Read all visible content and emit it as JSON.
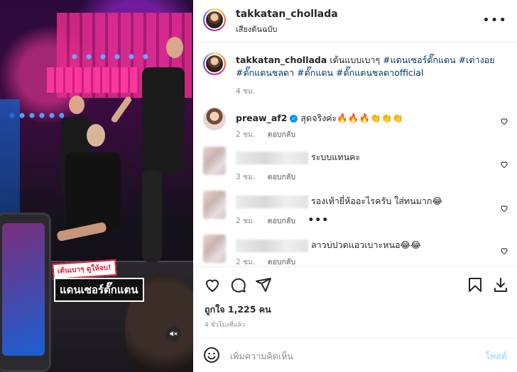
{
  "media": {
    "overlay_top": "เต้นเบาๆ ดูให้จบ!",
    "overlay_main": "แดนเซอร์ตั๊กแตน",
    "mute_icon": "speaker-muted-icon"
  },
  "header": {
    "username": "takkatan_chollada",
    "audio": "เสียงต้นฉบับ",
    "more": "•••"
  },
  "caption": {
    "username": "takkatan_chollada",
    "text": "เต้นแบบเบาๆ",
    "hashtags": [
      "#แดนเซอร์ตั๊กแตน",
      "#เต่างอย",
      "#ตั๊กแตนชลดา",
      "#ตั๊กแตน",
      "#ตั๊กแตนชลดาofficial"
    ],
    "time": "4 ชม."
  },
  "comments": [
    {
      "username": "preaw_af2",
      "verified": true,
      "text": "สุดจริงค่ะ🔥🔥🔥👏👏👏",
      "time": "2 ชม.",
      "reply": "ตอบกลับ",
      "blurred": false
    },
    {
      "username": "",
      "verified": false,
      "text": "ระบบแทนคะ",
      "time": "3 ชม.",
      "reply": "ตอบกลับ",
      "blurred": true
    },
    {
      "username": "",
      "verified": false,
      "text": "รองเท้ายี่ห้ออะไรครับ ใส่ทนมาก😂",
      "time": "2 ชม.",
      "reply": "ตอบกลับ",
      "blurred": true
    },
    {
      "username": "",
      "verified": false,
      "text": "ลาวบ่ปวดแอวเบาะหนอ😂😂",
      "time": "2 ชม.",
      "reply": "ตอบกลับ",
      "blurred": true
    }
  ],
  "more_dots": "•••",
  "likes": "ถูกใจ 1,225 คน",
  "posted_ago": "4 ชั่วโมงที่แล้ว",
  "add_comment": {
    "placeholder": "เพิ่มความคิดเห็น",
    "post_label": "โพสต์"
  },
  "colors": {
    "text": "#262626",
    "secondary": "#8e8e8e",
    "verified": "#0095f6",
    "hashtag": "#00376b",
    "post_disabled": "#b2dffc"
  }
}
